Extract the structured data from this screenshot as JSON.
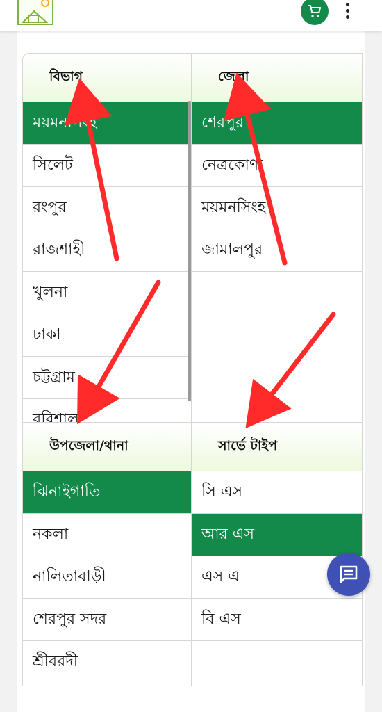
{
  "header": {
    "logo_icon": "house-with-sun-logo-icon",
    "cart_icon": "shopping-cart-icon",
    "more_icon": "more-vertical-icon"
  },
  "colors": {
    "brand_green": "#148a4a",
    "chat_blue": "#3f51b5",
    "arrow_red": "#ff2a2a",
    "header_gradient": "#eef9df"
  },
  "panels": {
    "division": {
      "title": "বিভাগ",
      "items": [
        "ময়মনসিংহ",
        "সিলেট",
        "রংপুর",
        "রাজশাহী",
        "খুলনা",
        "ঢাকা",
        "চট্টগ্রাম",
        "বরিশাল"
      ],
      "selected": 0
    },
    "district": {
      "title": "জেলা",
      "items": [
        "শেরপুর",
        "নেত্রকোণা",
        "ময়মনসিংহ",
        "জামালপুর"
      ],
      "selected": 0
    },
    "upazila": {
      "title": "উপজেলা/থানা",
      "items": [
        "ঝিনাইগাতি",
        "নকলা",
        "নালিতাবাড়ী",
        "শেরপুর সদর",
        "শ্রীবরদী"
      ],
      "selected": 0
    },
    "survey": {
      "title": "সার্ভে টাইপ",
      "items": [
        "সি এস",
        "আর এস",
        "এস এ",
        "বি এস"
      ],
      "selected": 1
    }
  },
  "chat": {
    "icon": "chat-message-icon"
  }
}
